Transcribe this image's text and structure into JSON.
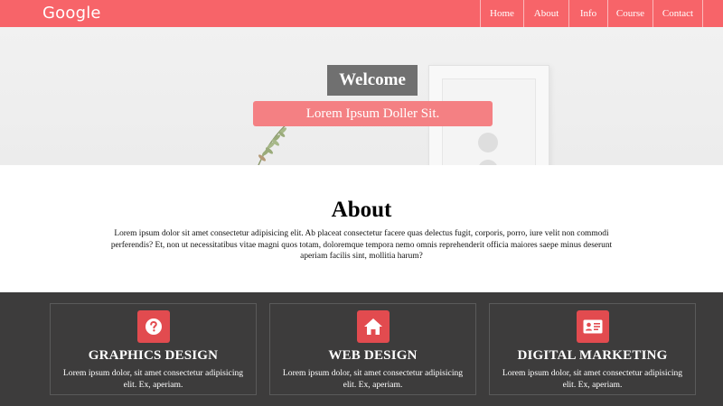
{
  "navbar": {
    "logo": "Google",
    "links": [
      {
        "label": "Home"
      },
      {
        "label": "About"
      },
      {
        "label": "Info"
      },
      {
        "label": "Course"
      },
      {
        "label": "Contact"
      }
    ]
  },
  "hero": {
    "heading": "Welcome",
    "tagline": "Lorem Ipsum Doller Sit."
  },
  "about": {
    "title": "About",
    "text": "Lorem ipsum dolor sit amet consectetur adipisicing elit. Ab placeat consectetur facere quas delectus fugit, corporis, porro, iure velit non commodi perferendis? Et, non ut necessitatibus vitae magni quos totam, doloremque tempora nemo omnis reprehenderit officia maiores saepe minus deserunt aperiam facilis sint, mollitia harum?"
  },
  "services": [
    {
      "icon": "question-icon",
      "title": "GRAPHICS DESIGN",
      "text": "Lorem ipsum dolor, sit amet consectetur adipisicing elit. Ex, aperiam."
    },
    {
      "icon": "home-icon",
      "title": "WEB DESIGN",
      "text": "Lorem ipsum dolor, sit amet consectetur adipisicing elit. Ex, aperiam."
    },
    {
      "icon": "id-card-icon",
      "title": "DIGITAL MARKETING",
      "text": "Lorem ipsum dolor, sit amet consectetur adipisicing elit. Ex, aperiam."
    }
  ],
  "colors": {
    "accent": "#f76469",
    "icon_bg": "#e24b4f",
    "dark_section": "#3d3c3c",
    "welcome_bg": "#707070",
    "tagline_bg": "#f48083"
  }
}
